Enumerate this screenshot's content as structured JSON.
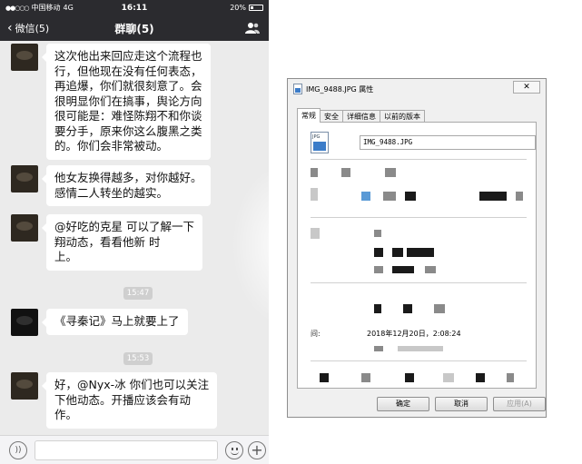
{
  "statusbar": {
    "carrier": "中国移动",
    "network": "4G",
    "time": "16:11",
    "battery": "20%",
    "battery_level": 0.2
  },
  "navbar": {
    "back_label": "微信(5)",
    "title": "群聊(5)"
  },
  "messages": [
    {
      "text": "这次他出来回应走这个流程也\n行，但他现在没有任何表态，\n再追爆，你们就很刻意了。会\n很明显你们在搞事，舆论方向\n很可能是：难怪陈翔不和你谈\n要分手，原来你这么腹黑之类\n的。你们会非常被动。"
    },
    {
      "text": "他女友换得越多，对你越好。\n感情二人转坐的越实。"
    },
    {
      "text": "@好吃的克星 可以了解一下\n翔动态，看看他新     时\n上。"
    },
    {
      "text": "《寻秦记》马上就要上了"
    },
    {
      "text": "好，@Nyx-冰 你们也可以关注\n下他动态。开播应该会有动\n作。"
    }
  ],
  "timestamps": [
    "15:47",
    "15:53"
  ],
  "dialog": {
    "title": "IMG_9488.JPG 属性",
    "close_label": "✕",
    "tabs": [
      "常规",
      "安全",
      "详细信息",
      "以前的版本"
    ],
    "icon_label": "JPG",
    "filename": "IMG_9488.JPG",
    "created_label": "间:",
    "created_value": "2018年12月20日，2:08:24",
    "buttons": {
      "ok": "确定",
      "cancel": "取消",
      "apply": "应用(A)"
    }
  },
  "colors": {
    "wechat_bar": "#2b2b2f",
    "chat_background": "#ebebeb",
    "dialog_background": "#f0f0f0"
  }
}
